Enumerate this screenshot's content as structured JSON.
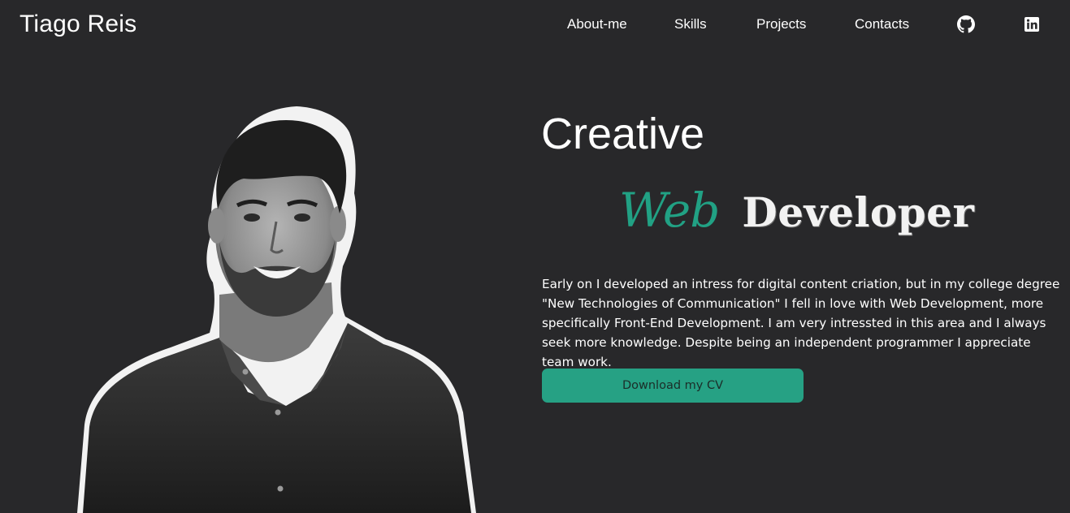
{
  "header": {
    "site_name": "Tiago Reis",
    "nav": {
      "about": "About-me",
      "skills": "Skills",
      "projects": "Projects",
      "contacts": "Contacts"
    },
    "icons": [
      "github-icon",
      "linkedin-icon"
    ]
  },
  "hero": {
    "title": "Creative",
    "role_first": "Web",
    "role_second": "Developer",
    "bio": "Early on I developed an intress for digital content criation, but in my college degree \"New Technologies of Communication\" I fell in love with Web Development, more specifically Front-End Development. I am very intressted in this area and I always seek more knowledge. Despite being an independent programmer I appreciate team work.",
    "cv_button": "Download my CV"
  },
  "colors": {
    "background": "#28282a",
    "accent": "#26a184",
    "text": "#ffffff"
  }
}
